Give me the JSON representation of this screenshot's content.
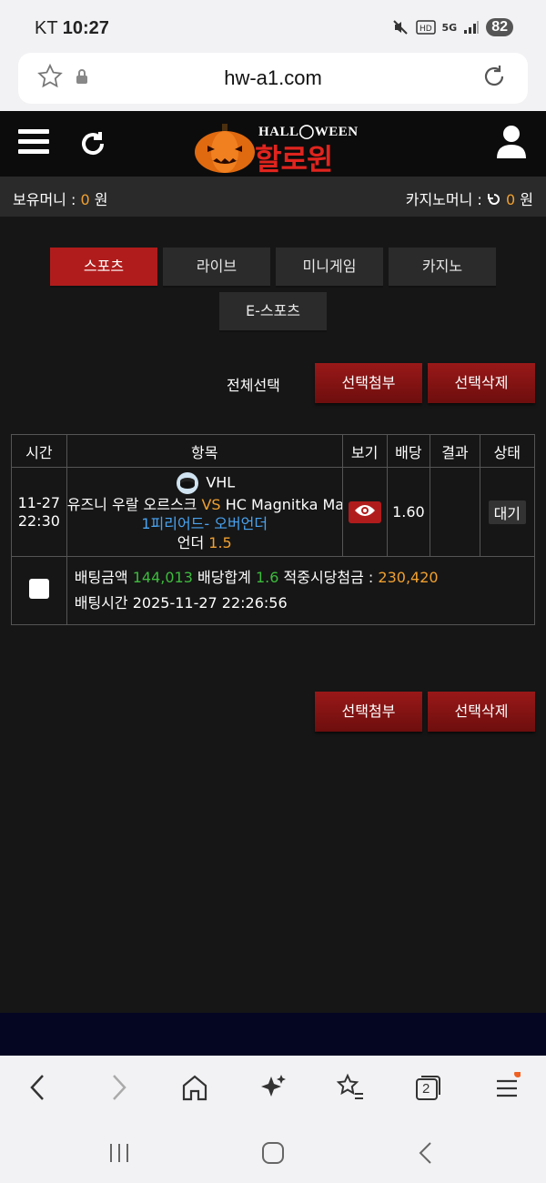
{
  "status_bar": {
    "carrier": "KT",
    "time": "10:27",
    "battery": "82",
    "network": "5G"
  },
  "browser": {
    "url": "hw-a1.com",
    "tab_count": "2"
  },
  "site": {
    "logo_top": "HALL◯WEEN",
    "logo_main": "할로윈"
  },
  "money": {
    "holding_label": "보유머니 :",
    "holding_value": "0",
    "holding_unit": "원",
    "casino_label": "카지노머니 :",
    "casino_value": "0",
    "casino_unit": "원"
  },
  "tabs": [
    {
      "label": "스포츠",
      "active": true
    },
    {
      "label": "라이브",
      "active": false
    },
    {
      "label": "미니게임",
      "active": false
    },
    {
      "label": "카지노",
      "active": false
    },
    {
      "label": "E-스포츠",
      "active": false
    }
  ],
  "actions": {
    "select_all": "전체선택",
    "attach": "선택첨부",
    "delete": "선택삭제"
  },
  "table": {
    "headers": [
      "시간",
      "항목",
      "보기",
      "배당",
      "결과",
      "상태"
    ],
    "bet": {
      "date": "11-27",
      "time": "22:30",
      "league": "VHL",
      "home": "유즈니 우랄 오르스크",
      "vs": "VS",
      "away": "HC Magnitka Magnitogorsk",
      "market": "1피리어드- 오버언더",
      "pick": "언더",
      "pick_value": "1.5",
      "odds": "1.60",
      "result": "",
      "status": "대기"
    },
    "summary": {
      "amount_label": "배팅금액",
      "amount": "144,013",
      "total_odds_label": "배당합계",
      "total_odds": "1.6",
      "payout_label": "적중시당첨금 :",
      "payout": "230,420",
      "time_label": "배팅시간",
      "time": "2025-11-27 22:26:56"
    }
  }
}
